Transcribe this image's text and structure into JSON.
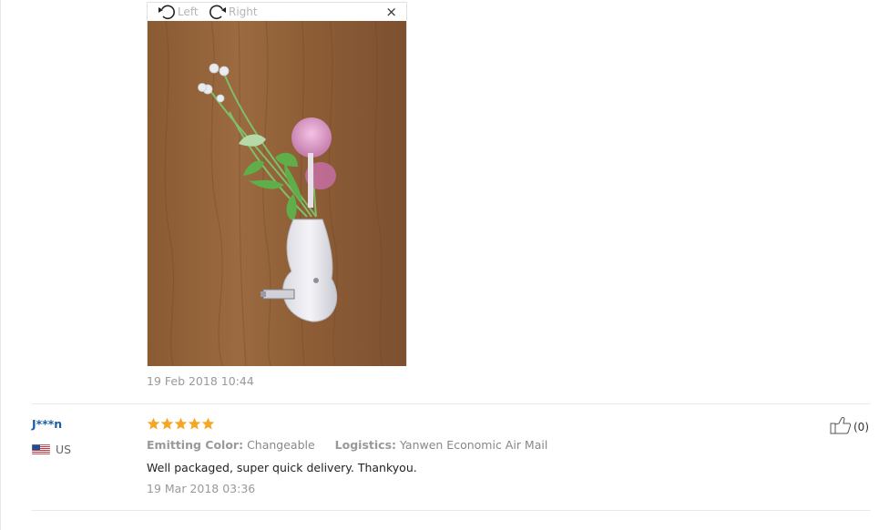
{
  "viewer": {
    "rotate_left_label": "Left",
    "rotate_right_label": "Right",
    "close_glyph": "×"
  },
  "review_1": {
    "date": "19 Feb 2018 10:44"
  },
  "review_2": {
    "buyer_name": "J***n",
    "country": "US",
    "rating": 5,
    "emitting_color_label": "Emitting Color:",
    "emitting_color_value": "Changeable",
    "logistics_label": "Logistics:",
    "logistics_value": "Yanwen Economic Air Mail",
    "text": "Well packaged, super quick delivery. Thankyou.",
    "date": "19 Mar 2018 03:36",
    "helpful_count": "(0)"
  },
  "colors": {
    "star": "#f5a623",
    "buyer_link": "#1b5ea8",
    "muted_text": "#999999",
    "divider": "#eaeaea"
  },
  "icons": {
    "rotate_left": "rotate-left-icon",
    "rotate_right": "rotate-right-icon",
    "close": "close-icon",
    "flag": "us-flag-icon",
    "star": "star-icon",
    "thumbs_up": "thumbs-up-icon"
  }
}
